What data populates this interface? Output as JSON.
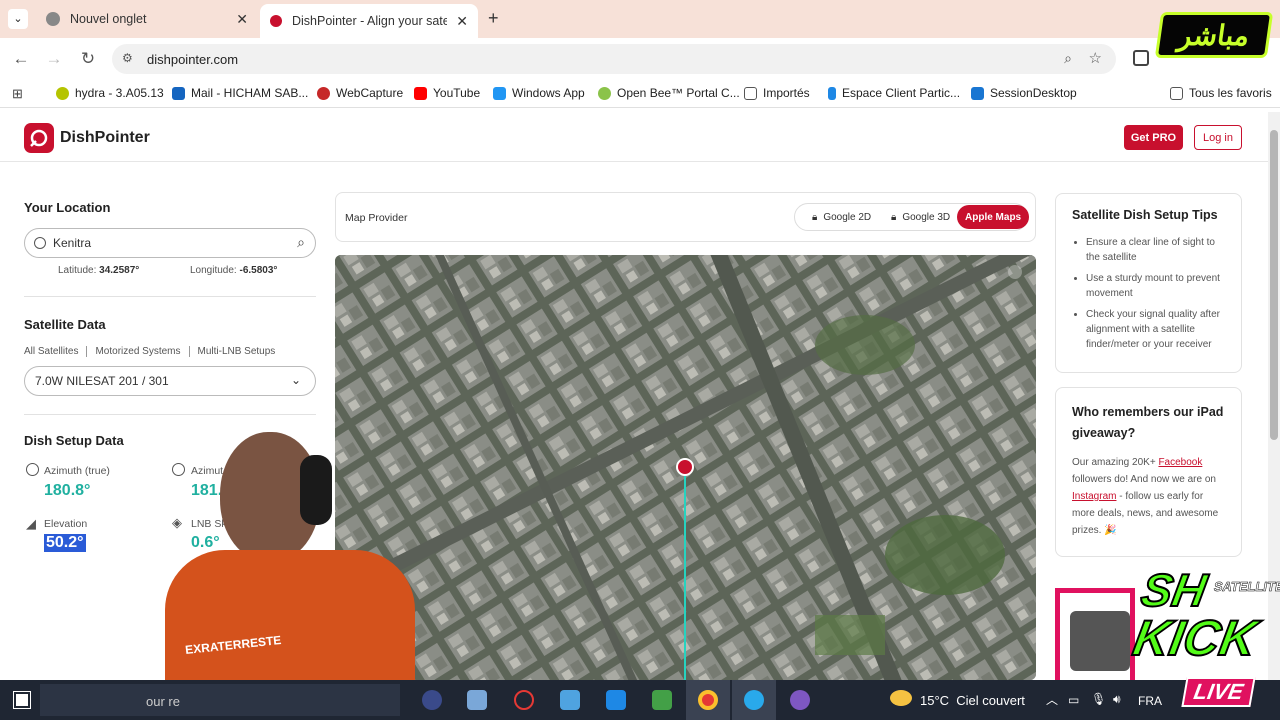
{
  "browser": {
    "tabs": [
      {
        "title": "Nouvel onglet",
        "icon": "chrome-icon"
      },
      {
        "title": "DishPointer - Align your satellit",
        "icon": "dishpointer-icon"
      }
    ],
    "url": "dishpointer.com",
    "bookmarks": [
      "hydra - 3.A05.13",
      "Mail - HICHAM SAB...",
      "WebCapture",
      "YouTube",
      "Windows App",
      "Open Bee™ Portal C...",
      "Importés",
      "Espace Client Partic...",
      "SessionDesktop"
    ],
    "all_bookmarks": "Tous les favoris"
  },
  "site": {
    "brand": "DishPointer",
    "get_pro": "Get PRO",
    "login": "Log in",
    "location": {
      "heading": "Your Location",
      "value": "Kenitra",
      "latitude_label": "Latitude:",
      "latitude": "34.2587°",
      "longitude_label": "Longitude:",
      "longitude": "-6.5803°"
    },
    "satellite": {
      "heading": "Satellite Data",
      "filters": [
        "All Satellites",
        "Motorized Systems",
        "Multi-LNB Setups"
      ],
      "selected": "7.0W NILESAT 201 / 301"
    },
    "dish": {
      "heading": "Dish Setup Data",
      "azimuth_true_label": "Azimuth (true)",
      "azimuth_true": "180.8°",
      "azimuth_mag_label": "Azimut",
      "azimuth_mag": "181.",
      "elevation_label": "Elevation",
      "elevation": "50.2°",
      "lnb_label": "LNB Sk",
      "lnb": "0.6°"
    },
    "map": {
      "provider_label": "Map Provider",
      "options": [
        "Google 2D",
        "Google 3D",
        "Apple Maps"
      ],
      "selected": "Apple Maps"
    },
    "tips": {
      "heading": "Satellite Dish Setup Tips",
      "items": [
        "Ensure a clear line of sight to the satellite",
        "Use a sturdy mount to prevent movement",
        "Check your signal quality after alignment with a satellite finder/meter or your receiver"
      ]
    },
    "giveaway": {
      "heading": "Who remembers our iPad giveaway?",
      "text1": "Our amazing 20K+ ",
      "facebook": "Facebook",
      "text2": " followers do! And now we are on ",
      "instagram": "Instagram",
      "text3": " - follow us early for more deals, news, and awesome prizes. 🎉"
    }
  },
  "overlay": {
    "badge": "مباشر",
    "kick_brand": "SH",
    "kick_sub": "SATELLITE",
    "kick": "KICK",
    "live": "LIVE",
    "shirt_text": "EXRATERRESTE",
    "partial_text": "our re"
  },
  "taskbar": {
    "weather": "15°C  Ciel couvert",
    "lang": "FRA"
  },
  "colors": {
    "brand": "#c8102e",
    "accent": "#20b0a0"
  }
}
